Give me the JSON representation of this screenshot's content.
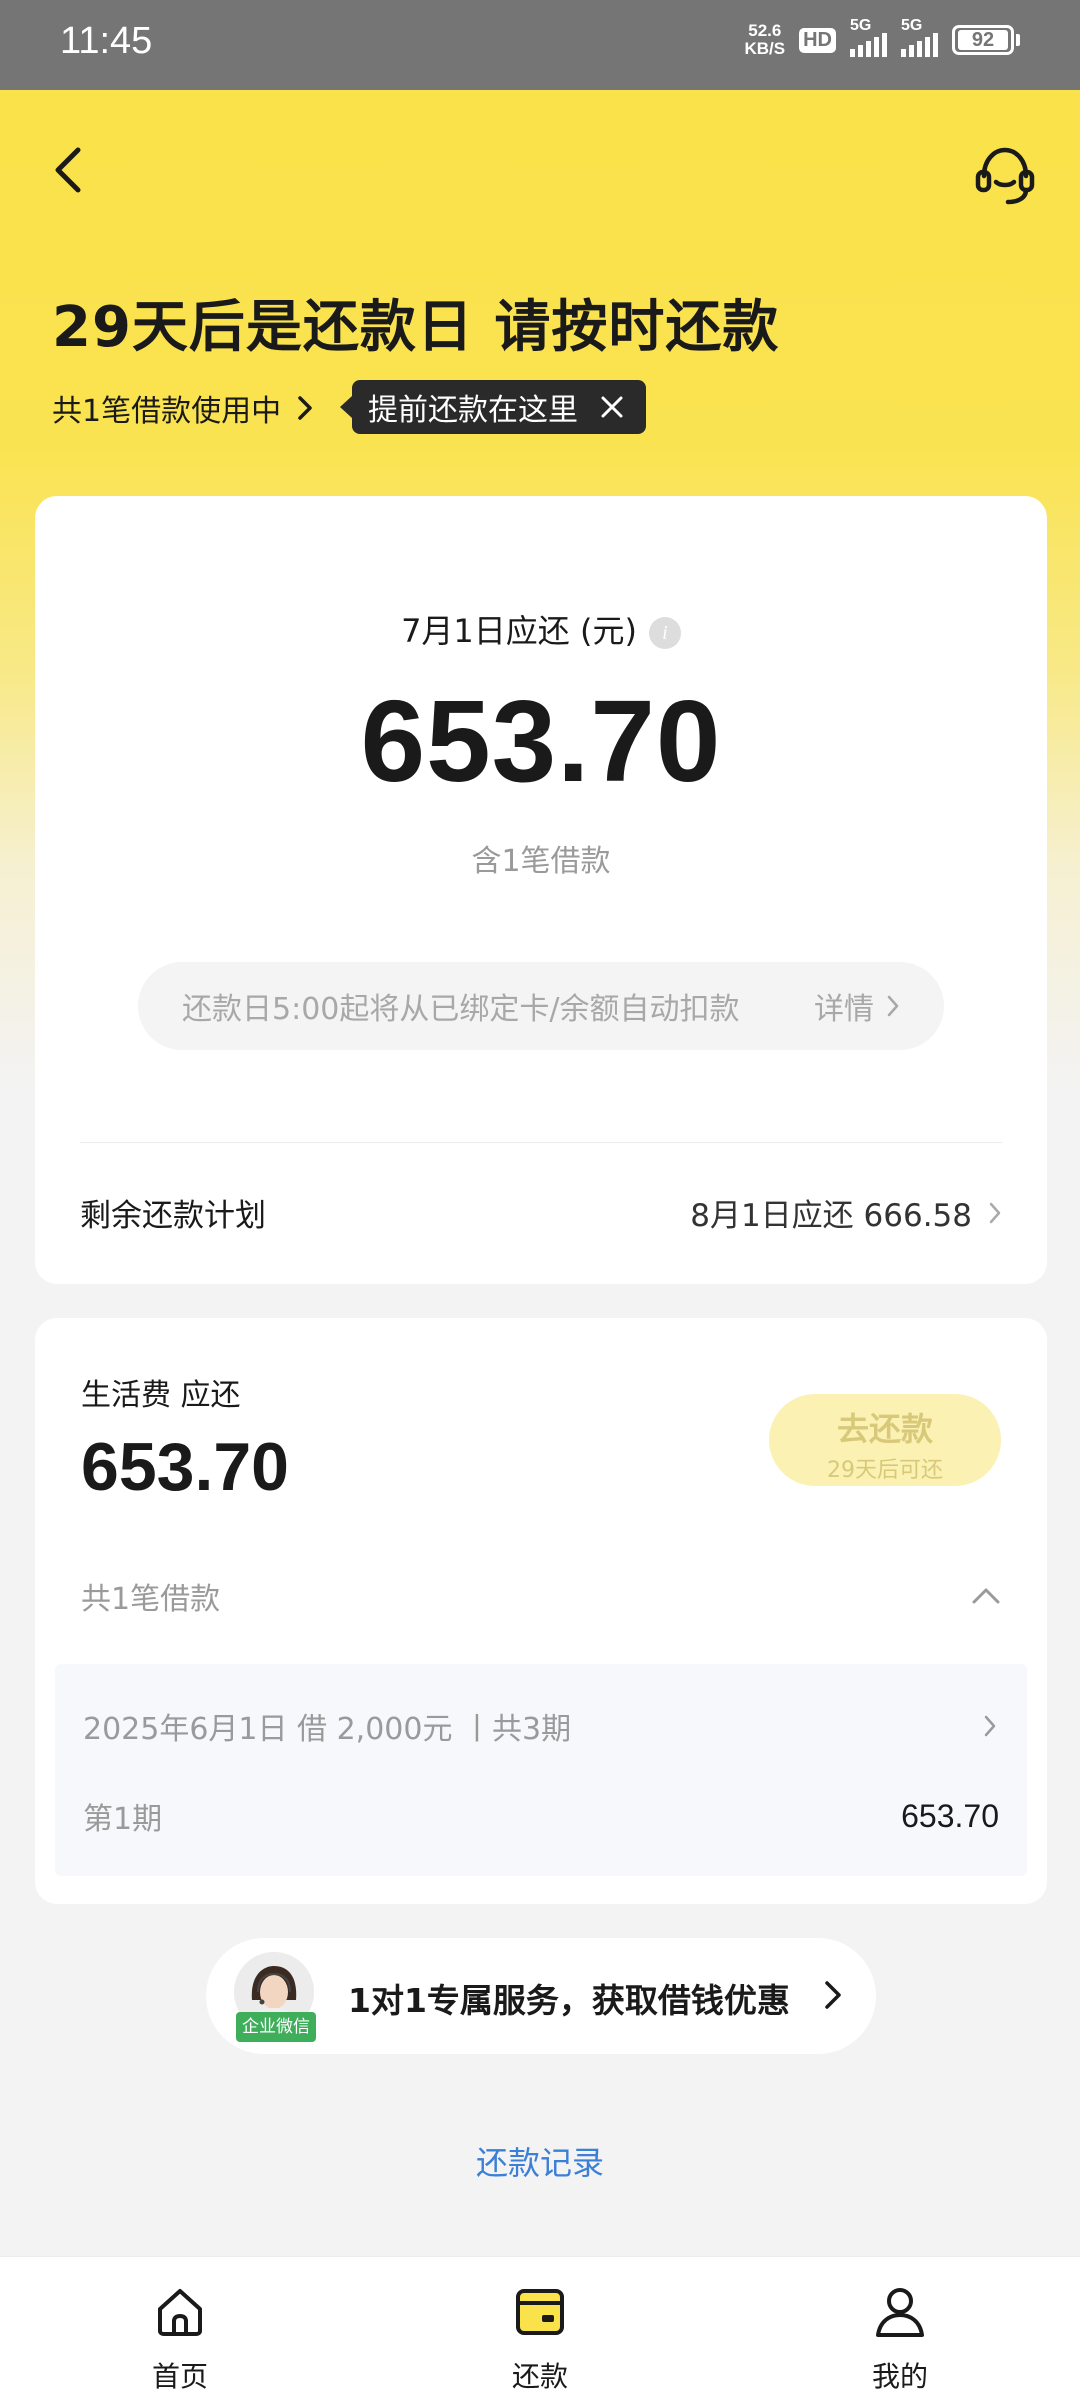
{
  "status_bar": {
    "time": "11:45",
    "net_speed_value": "52.6",
    "net_speed_unit": "KB/S",
    "hd_badge": "HD",
    "signal_1_label": "5G",
    "signal_2_label": "5G",
    "battery": "92"
  },
  "header": {
    "back_icon": "chevron-left-icon",
    "service_icon": "headset-icon",
    "headline": "29天后是还款日 请按时还款",
    "loan_count": "共1笔借款使用中",
    "tooltip": "提前还款在这里"
  },
  "main_card": {
    "due_label": "7月1日应还 (元)",
    "info_icon": "i",
    "amount": "653.70",
    "sub_note": "含1笔借款",
    "auto_debit_text": "还款日5:00起将从已绑定卡/余额自动扣款",
    "detail_label": "详情",
    "plan_label": "剩余还款计划",
    "plan_value": "8月1日应还 666.58"
  },
  "loan_card": {
    "title": "生活费 应还",
    "amount": "653.70",
    "pay_button_label": "去还款",
    "pay_button_sub": "29天后可还",
    "loan_count": "共1笔借款",
    "loan_item": {
      "desc": "2025年6月1日 借 2,000元 丨共3期",
      "period_label": "第1期",
      "period_amount": "653.70"
    }
  },
  "service": {
    "tag": "企业微信",
    "text": "1对1专属服务，获取借钱优惠"
  },
  "record_link": "还款记录",
  "tabbar": {
    "tabs": [
      {
        "label": "首页",
        "icon": "home-icon"
      },
      {
        "label": "还款",
        "icon": "wallet-icon"
      },
      {
        "label": "我的",
        "icon": "user-icon"
      }
    ]
  },
  "colors": {
    "brand_yellow": "#fae24a",
    "link_blue": "#3c7fd6",
    "pay_button_disabled": "#fbf1b3"
  }
}
